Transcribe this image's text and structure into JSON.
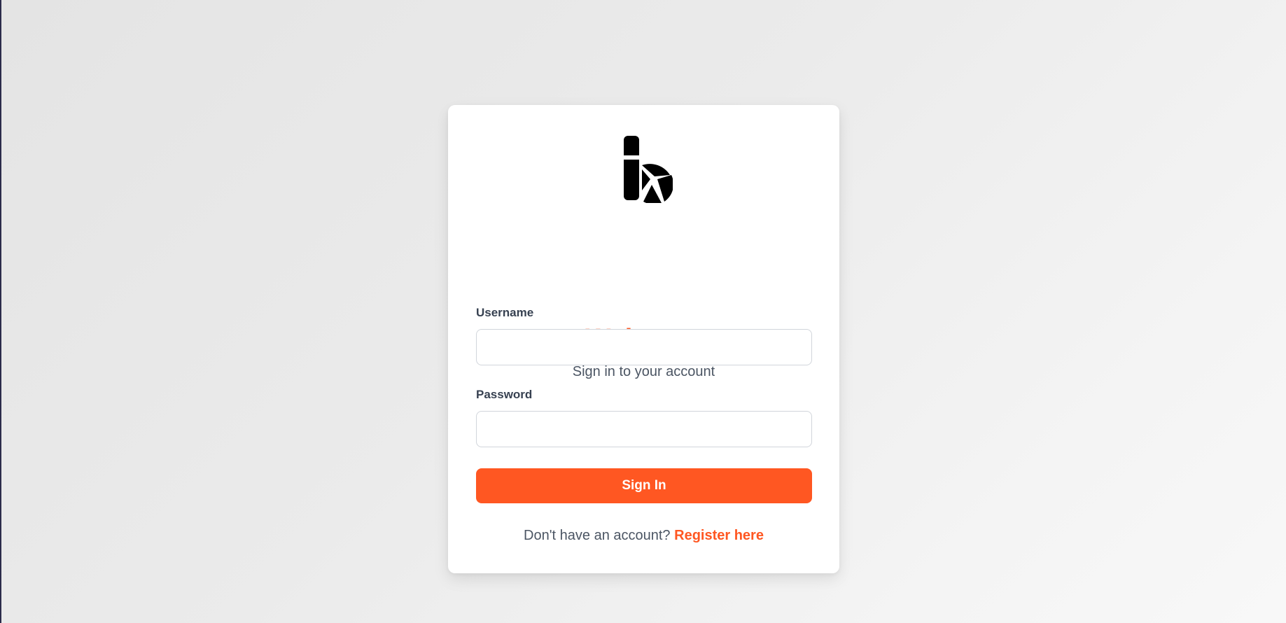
{
  "login": {
    "logo_icon": "brand-b-logo-icon",
    "title": "Welcome",
    "subtitle": "Sign in to your account",
    "username_label": "Username",
    "username_value": "",
    "password_label": "Password",
    "password_value": "",
    "signin_label": "Sign In",
    "footer_text": "Don't have an account?",
    "register_link": "Register here"
  },
  "colors": {
    "accent": "#ff5722",
    "card_background": "#ffffff",
    "page_background": "#ebebeb",
    "text_muted": "#4b5563",
    "label_text": "#374151",
    "input_border": "#d1d5db"
  }
}
